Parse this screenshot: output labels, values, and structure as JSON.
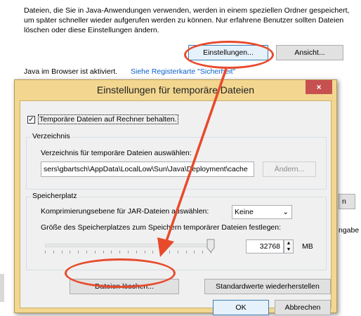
{
  "background": {
    "description_text": "Dateien, die Sie in Java-Anwendungen verwenden, werden in einem speziellen Ordner gespeichert, um später schneller wieder aufgerufen werden zu können. Nur erfahrene Benutzer sollten Dateien löschen oder diese Einstellungen ändern.",
    "settings_button": "Einstellungen...",
    "view_button": "Ansicht...",
    "java_status": "Java im Browser ist aktiviert.",
    "security_link": "Siehe Registerkarte \"Sicherheit\"",
    "partial_button_right": "n",
    "partial_text_right": "ngabe"
  },
  "dialog": {
    "title": "Einstellungen für temporäre Dateien",
    "close_glyph": "×",
    "keep_files_label": "Temporäre Dateien auf Rechner behalten.",
    "keep_files_checked": true,
    "check_glyph": "✓",
    "directory": {
      "group_label": "Verzeichnis",
      "instruction": "Verzeichnis für temporäre Dateien auswählen:",
      "path": "sers\\gbartsch\\AppData\\LocalLow\\Sun\\Java\\Deployment\\cache",
      "change_button": "Ändern..."
    },
    "storage": {
      "group_label": "Speicherplatz",
      "compression_label": "Komprimierungsebene für JAR-Dateien auswählen:",
      "compression_value": "Keine",
      "size_label": "Größe des Speicherplatzes zum Speichern temporärer Dateien festlegen:",
      "size_value": "32768",
      "size_unit": "MB",
      "slider_level": 1.0
    },
    "delete_button": "Dateien löschen...",
    "restore_button": "Standardwerte wiederherstellen",
    "ok_button": "OK",
    "cancel_button": "Abbrechen"
  },
  "colors": {
    "annotation": "#e84a2c",
    "dialog_frame": "#f3d790",
    "close_button": "#c75050"
  }
}
